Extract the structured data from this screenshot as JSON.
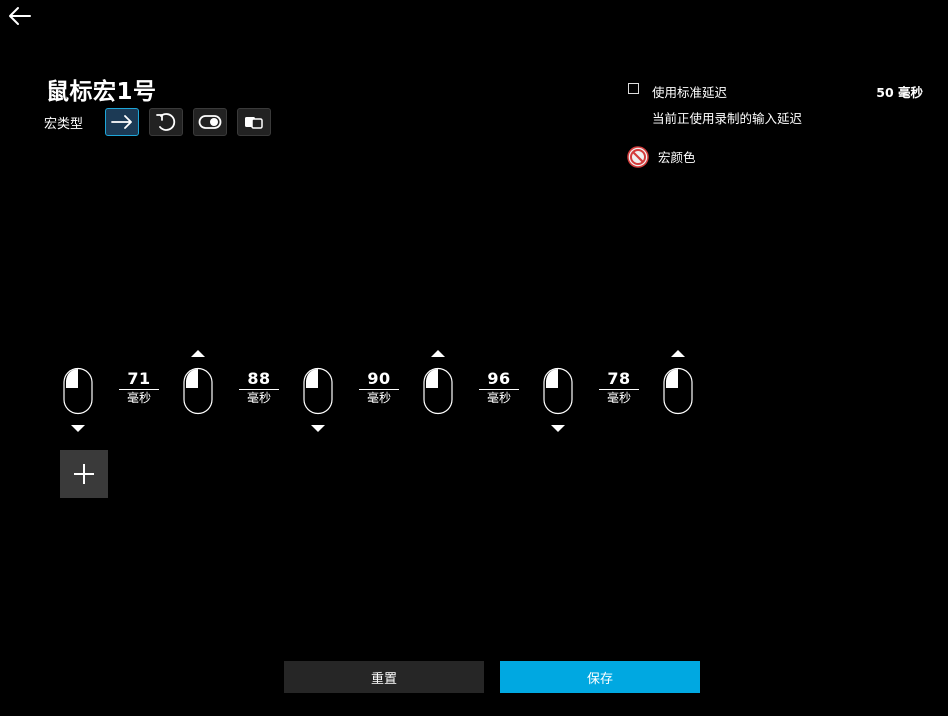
{
  "header": {
    "back_icon": "back-arrow-icon"
  },
  "macro": {
    "title": "鼠标宏1号",
    "type_label": "宏类型",
    "types": [
      {
        "icon": "arrow-right-icon",
        "active": true
      },
      {
        "icon": "repeat-loop-icon",
        "active": false
      },
      {
        "icon": "toggle-icon",
        "active": false
      },
      {
        "icon": "sequence-icon",
        "active": false
      }
    ]
  },
  "settings": {
    "standard_delay_label": "使用标准延迟",
    "standard_delay_checked": false,
    "standard_delay_value": "50 毫秒",
    "recorded_delay_text": "当前正使用录制的输入延迟",
    "color_label": "宏颜色",
    "color_icon": "no-color-icon"
  },
  "sequence": {
    "steps": [
      {
        "icon": "mouse-left-button-icon",
        "action": "down"
      },
      {
        "delay": "71",
        "unit": "毫秒"
      },
      {
        "icon": "mouse-left-button-icon",
        "action": "up"
      },
      {
        "delay": "88",
        "unit": "毫秒"
      },
      {
        "icon": "mouse-left-button-icon",
        "action": "down"
      },
      {
        "delay": "90",
        "unit": "毫秒"
      },
      {
        "icon": "mouse-left-button-icon",
        "action": "up"
      },
      {
        "delay": "96",
        "unit": "毫秒"
      },
      {
        "icon": "mouse-left-button-icon",
        "action": "down"
      },
      {
        "delay": "78",
        "unit": "毫秒"
      },
      {
        "icon": "mouse-left-button-icon",
        "action": "up"
      }
    ],
    "add_icon": "plus-icon"
  },
  "footer": {
    "reset_label": "重置",
    "save_label": "保存"
  },
  "colors": {
    "accent": "#00a8e1",
    "active_border": "#1ea6d8",
    "button_dark": "#262626",
    "add_bg": "#3a3a3a",
    "no_color_red": "#d43c3c"
  }
}
